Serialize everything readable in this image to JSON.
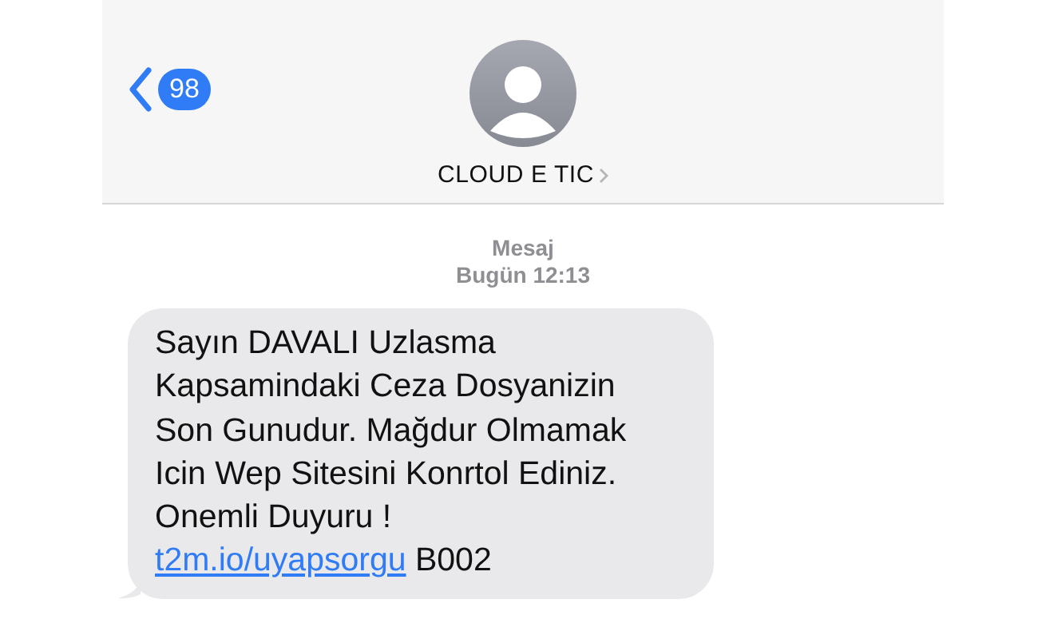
{
  "header": {
    "unread_count": "98",
    "contact_name": "CLOUD E TIC"
  },
  "thread": {
    "service": "Mesaj",
    "timestamp": "Bugün 12:13"
  },
  "message": {
    "lines": [
      "Sayın DAVALI Uzlasma",
      "Kapsamindaki Ceza Dosyanizin",
      "Son Gunudur. Mağdur Olmamak",
      "Icin Wep Sitesini Konrtol Ediniz.",
      "Onemli Duyuru !"
    ],
    "link": "t2m.io/uyapsorgu",
    "suffix": "B002"
  }
}
